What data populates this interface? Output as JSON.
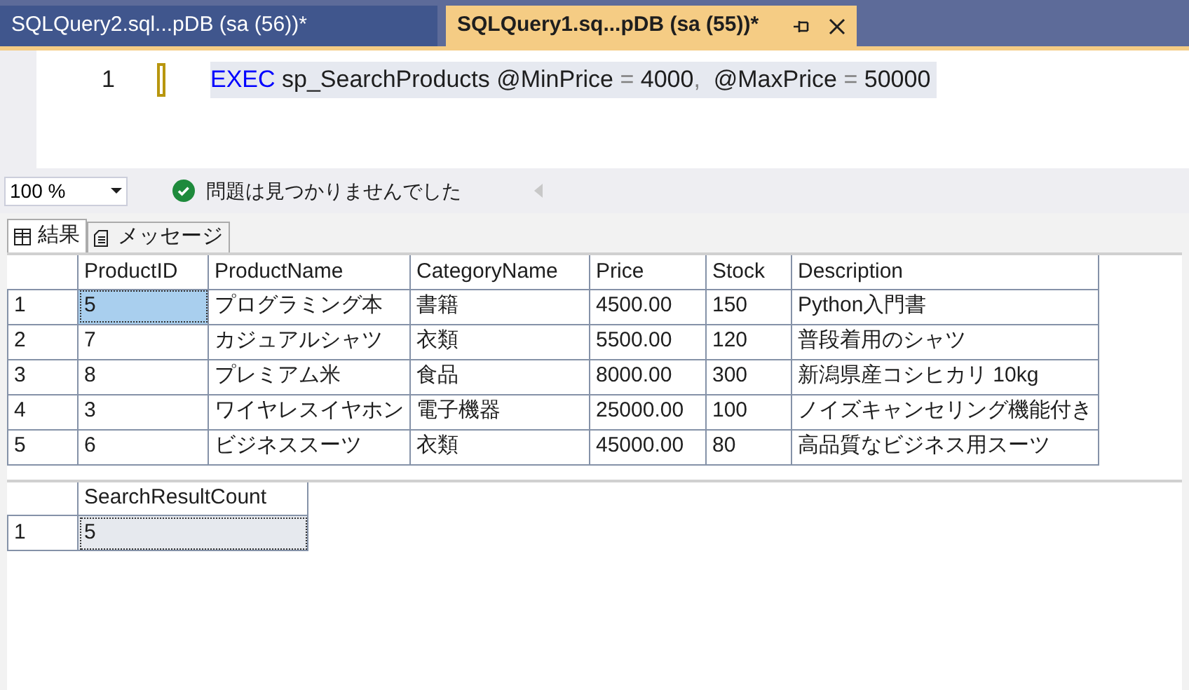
{
  "tabs": [
    {
      "label": "SQLQuery2.sql...pDB (sa (56))*",
      "selected": false
    },
    {
      "label": "SQLQuery1.sq...pDB (sa (55))*",
      "selected": true
    }
  ],
  "editor": {
    "lines": [
      {
        "number": "1",
        "changed": true,
        "current": true,
        "tokens": [
          {
            "kind": "keyword",
            "text": "EXEC"
          },
          {
            "kind": "plain",
            "text": " sp_SearchProducts @MinPrice "
          },
          {
            "kind": "operator",
            "text": "="
          },
          {
            "kind": "plain",
            "text": " 4000"
          },
          {
            "kind": "operator",
            "text": ","
          },
          {
            "kind": "plain",
            "text": "  @MaxPrice "
          },
          {
            "kind": "operator",
            "text": "="
          },
          {
            "kind": "plain",
            "text": " 50000"
          }
        ]
      }
    ]
  },
  "status": {
    "zoom": "100 %",
    "message": "問題は見つかりませんでした"
  },
  "result_tabs": [
    {
      "label": "結果",
      "kind": "grid",
      "selected": true
    },
    {
      "label": "メッセージ",
      "kind": "messages",
      "selected": false
    }
  ],
  "grids": [
    {
      "focused": true,
      "columns": [
        "ProductID",
        "ProductName",
        "CategoryName",
        "Price",
        "Stock",
        "Description"
      ],
      "rows": [
        {
          "number": "1",
          "cells": [
            {
              "text": "5",
              "selected": true
            },
            {
              "text": "プログラミング本",
              "selected": false
            },
            {
              "text": "書籍",
              "selected": false
            },
            {
              "text": "4500.00",
              "selected": false
            },
            {
              "text": "150",
              "selected": false
            },
            {
              "text": "Python入門書",
              "selected": false
            }
          ]
        },
        {
          "number": "2",
          "cells": [
            {
              "text": "7",
              "selected": false
            },
            {
              "text": "カジュアルシャツ",
              "selected": false
            },
            {
              "text": "衣類",
              "selected": false
            },
            {
              "text": "5500.00",
              "selected": false
            },
            {
              "text": "120",
              "selected": false
            },
            {
              "text": "普段着用のシャツ",
              "selected": false
            }
          ]
        },
        {
          "number": "3",
          "cells": [
            {
              "text": "8",
              "selected": false
            },
            {
              "text": "プレミアム米",
              "selected": false
            },
            {
              "text": "食品",
              "selected": false
            },
            {
              "text": "8000.00",
              "selected": false
            },
            {
              "text": "300",
              "selected": false
            },
            {
              "text": "新潟県産コシヒカリ 10kg",
              "selected": false
            }
          ]
        },
        {
          "number": "4",
          "cells": [
            {
              "text": "3",
              "selected": false
            },
            {
              "text": "ワイヤレスイヤホン",
              "selected": false
            },
            {
              "text": "電子機器",
              "selected": false
            },
            {
              "text": "25000.00",
              "selected": false
            },
            {
              "text": "100",
              "selected": false
            },
            {
              "text": "ノイズキャンセリング機能付き",
              "selected": false
            }
          ]
        },
        {
          "number": "5",
          "cells": [
            {
              "text": "6",
              "selected": false
            },
            {
              "text": "ビジネススーツ",
              "selected": false
            },
            {
              "text": "衣類",
              "selected": false
            },
            {
              "text": "45000.00",
              "selected": false
            },
            {
              "text": "80",
              "selected": false
            },
            {
              "text": "高品質なビジネス用スーツ",
              "selected": false
            }
          ]
        }
      ]
    },
    {
      "focused": false,
      "columns": [
        "SearchResultCount"
      ],
      "rows": [
        {
          "number": "1",
          "cells": [
            {
              "text": "5",
              "selected": true
            }
          ]
        }
      ]
    }
  ]
}
